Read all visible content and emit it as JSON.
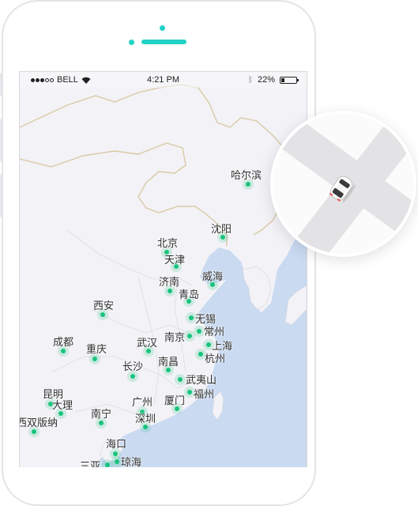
{
  "status_bar": {
    "carrier": "BELL",
    "time": "4:21 PM",
    "battery_percent": "22%",
    "signal_bars_filled": 3,
    "signal_bars_total": 5,
    "battery_level": 0.22
  },
  "icons": {
    "signal": "signal-dots-icon",
    "wifi": "wifi-icon",
    "bluetooth": "bluetooth-icon",
    "battery": "battery-icon",
    "car": "car-icon",
    "city_marker": "map-pin-icon"
  },
  "colors": {
    "accent": "#22d3c5",
    "pin": "#19c37d",
    "sea": "#c9daf1",
    "land": "#f3f2f6"
  },
  "map": {
    "cities": [
      {
        "name": "哈尔滨"
      },
      {
        "name": "沈阳"
      },
      {
        "name": "北京"
      },
      {
        "name": "天津"
      },
      {
        "name": "威海"
      },
      {
        "name": "济南"
      },
      {
        "name": "青岛"
      },
      {
        "name": "西安"
      },
      {
        "name": "无锡"
      },
      {
        "name": "南京"
      },
      {
        "name": "常州"
      },
      {
        "name": "上海"
      },
      {
        "name": "成都"
      },
      {
        "name": "武汉"
      },
      {
        "name": "杭州"
      },
      {
        "name": "重庆"
      },
      {
        "name": "南昌"
      },
      {
        "name": "长沙"
      },
      {
        "name": "武夷山"
      },
      {
        "name": "福州"
      },
      {
        "name": "昆明"
      },
      {
        "name": "广州"
      },
      {
        "name": "厦门"
      },
      {
        "name": "大理"
      },
      {
        "name": "深圳"
      },
      {
        "name": "南宁"
      },
      {
        "name": "西双版纳"
      },
      {
        "name": "海口"
      },
      {
        "name": "三亚"
      },
      {
        "name": "琼海"
      }
    ]
  }
}
